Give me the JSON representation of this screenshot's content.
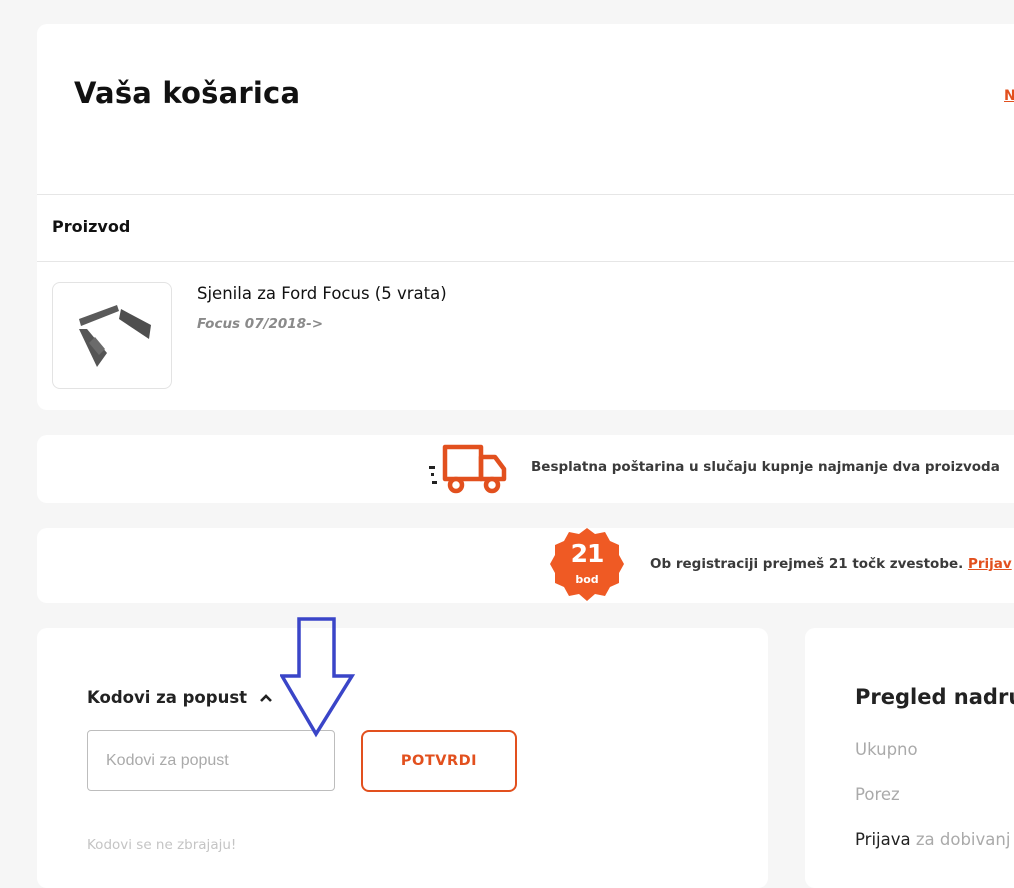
{
  "cart": {
    "title": "Vaša košarica",
    "top_link": "N",
    "column_header": "Proizvod",
    "item": {
      "name": "Sjenila za Ford Focus (5 vrata)",
      "model": "Focus 07/2018->"
    }
  },
  "shipping": {
    "icon": "truck-icon",
    "text": "Besplatna poštarina u slučaju kupnje najmanje dva proizvoda"
  },
  "loyalty": {
    "badge_number": "21",
    "badge_label": "bod",
    "text": "Ob registraciji prejmeš 21 točk zvestobe.",
    "link": "Prijav"
  },
  "discount": {
    "heading": "Kodovi za popust",
    "input_placeholder": "Kodovi za popust",
    "input_value": "",
    "confirm_label": "POTVRDI",
    "note": "Kodovi se ne zbrajaju!"
  },
  "summary": {
    "title": "Pregled nadru",
    "total_label": "Ukupno",
    "tax_label": "Porez",
    "login_link": "Prijava",
    "login_rest": "za dobivanj"
  },
  "colors": {
    "accent": "#e2501e",
    "annotation_arrow": "#3a45c8"
  }
}
